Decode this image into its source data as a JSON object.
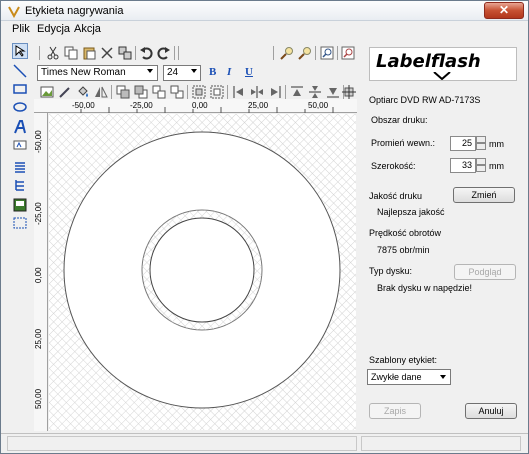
{
  "window": {
    "title": "Etykieta nagrywania",
    "close_label": "✕"
  },
  "menu": [
    "Plik",
    "Edycja",
    "Akcja"
  ],
  "font": {
    "name": "Times New Roman",
    "size": "24"
  },
  "format": {
    "bold": "B",
    "italic": "I",
    "underline": "U"
  },
  "ruler": {
    "h_ticks": [
      "-50,00",
      "-25,00",
      "0,00",
      "25,00",
      "50,00"
    ],
    "v_ticks": [
      "-50,00",
      "-25,00",
      "0,00",
      "25,00",
      "50,00"
    ]
  },
  "panel": {
    "logo": "Labelflash",
    "drive": "Optiarc DVD RW AD-7173S",
    "area_label": "Obszar druku:",
    "inner_radius_label": "Promień wewn.:",
    "inner_radius_value": "25",
    "width_label": "Szerokość:",
    "width_value": "33",
    "unit": "mm",
    "quality_label": "Jakość druku",
    "quality_value": "Najlepsza jakość",
    "change_button": "Zmień",
    "speed_label": "Prędkość obrotów",
    "speed_value": "7875 obr/min",
    "disc_type_label": "Typ dysku:",
    "disc_type_value": "Brak dysku w napędzie!",
    "preview_button": "Podgląd",
    "templates_label": "Szablony etykiet:",
    "templates_value": "Zwykłe dane",
    "save_button": "Zapis",
    "cancel_button": "Anuluj"
  }
}
